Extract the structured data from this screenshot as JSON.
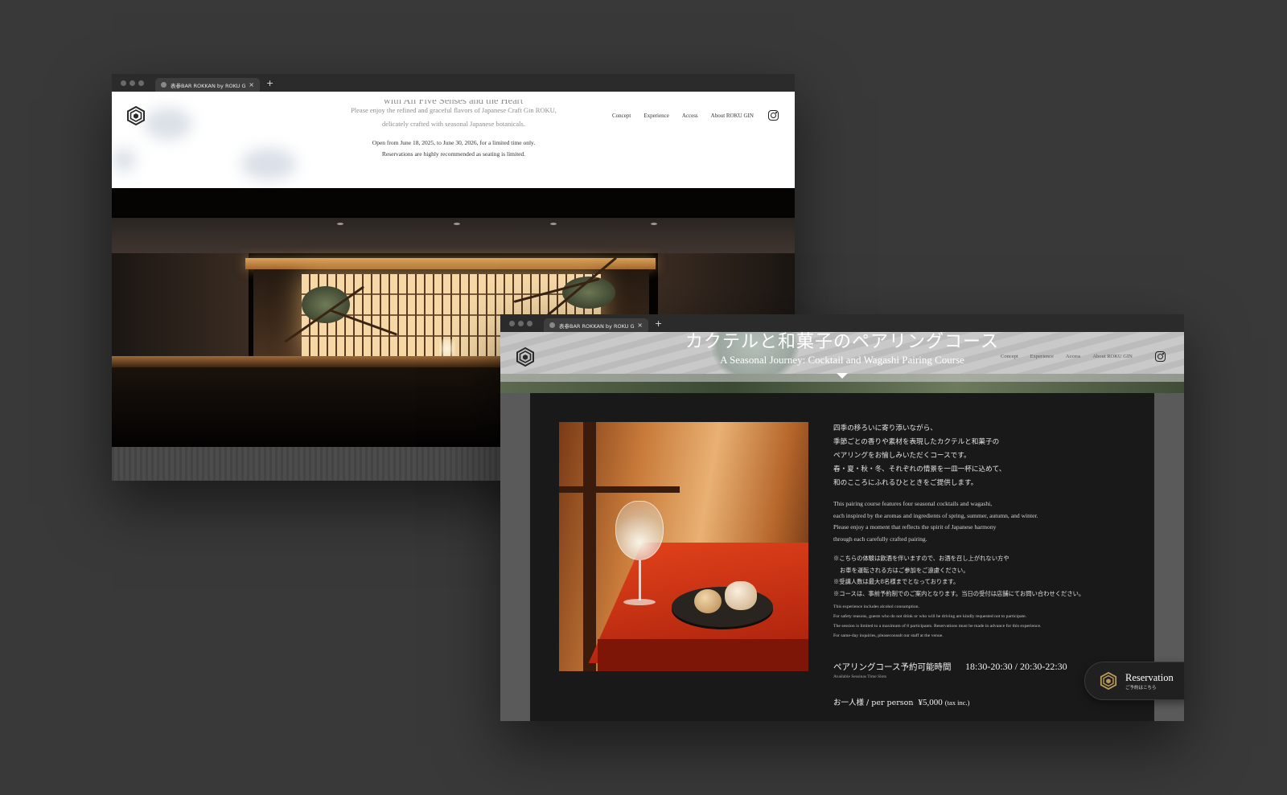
{
  "colors": {
    "background": "#393939",
    "gold": "#b99a55",
    "red_lacquer": "#d23a17"
  },
  "tab": {
    "title": "表参BAR ROKKAN by ROKU G",
    "close": "×",
    "new_tab": "+"
  },
  "window1": {
    "hero_cut_text": "with All Five Senses and the Heart",
    "intro": [
      "Please enjoy the refined and graceful flavors of Japanese Craft Gin ROKU,",
      "delicately crafted with seasonal Japanese botanicals."
    ],
    "dates": [
      "Open from June 18, 2025, to June 30, 2026, for a limited time only.",
      "Reservations are highly recommended as seating is limited."
    ],
    "nav": [
      "Concept",
      "Experience",
      "Access",
      "About ROKU GIN"
    ],
    "logo": "roku-hexagon-logo",
    "instagram": "instagram-icon"
  },
  "window2": {
    "title": "カクテルと和菓子のペアリングコース",
    "subtitle": "A Seasonal Journey: Cocktail and Wagashi Pairing Course",
    "nav": [
      "Concept",
      "Experience",
      "Access",
      "About ROKU GIN"
    ],
    "jp_paragraph": [
      "四季の移ろいに寄り添いながら、",
      "季節ごとの香りや素材を表現したカクテルと和菓子の",
      "ペアリングをお愉しみいただくコースです。",
      "春・夏・秋・冬、それぞれの情景を一皿一杯に込めて、",
      "和のこころにふれるひとときをご提供します。"
    ],
    "en_paragraph": [
      "This pairing course features four seasonal cocktails and wagashi,",
      "each inspired by the aromas and ingredients of spring, summer, autumn, and winter.",
      "Please enjoy a moment that reflects the spirit of Japanese harmony",
      "through each carefully crafted pairing."
    ],
    "notes_jp": [
      "※こちらの体験は飲酒を伴いますので、お酒を召し上がれない方や",
      "お車を運転される方はご参加をご遠慮ください。",
      "※受講人数は最大8名様までとなっております。",
      "※コースは、事前予約制でのご案内となります。当日の受付は店舗にてお問い合わせください。"
    ],
    "notes_en": [
      "This experience includes alcohol consumption.",
      "For safety reasons, guests who do not drink or who will be driving are kindly requested not to participate.",
      "The session is limited to a maximum of 8 participants. Reservations must be made in advance for this experience.",
      "For same-day inquiries, pleaseconsult our staff at the venue."
    ],
    "slot_label_jp": "ペアリングコース予約可能時間",
    "slot_times": "18:30-20:30 / 20:30-22:30",
    "slot_label_en": "Available Sessinas Time Slots",
    "price_label": "お一人様 / per person",
    "price_value": "¥5,000",
    "price_tax": "(tax inc.)",
    "reservation": {
      "title": "Reservation",
      "subtitle": "ご予約はこちら"
    }
  }
}
